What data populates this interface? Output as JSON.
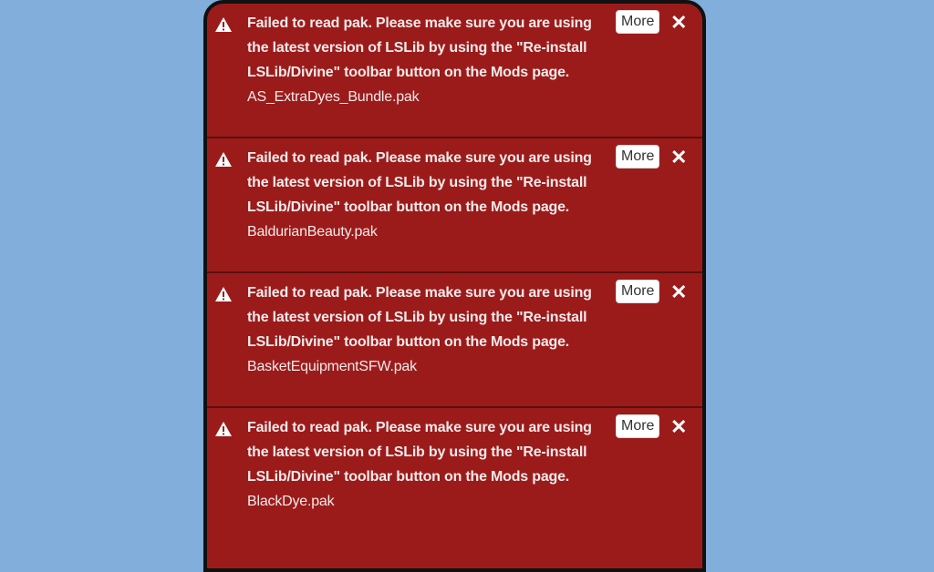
{
  "notifications": [
    {
      "message": "Failed to read pak. Please make sure you are using the latest version of LSLib by using the \"Re-install LSLib/Divine\" toolbar button on the Mods page.",
      "file": "AS_ExtraDyes_Bundle.pak",
      "more_label": "More",
      "icon": "warning-icon"
    },
    {
      "message": "Failed to read pak. Please make sure you are using the latest version of LSLib by using the \"Re-install LSLib/Divine\" toolbar button on the Mods page.",
      "file": "BaldurianBeauty.pak",
      "more_label": "More",
      "icon": "warning-icon"
    },
    {
      "message": "Failed to read pak. Please make sure you are using the latest version of LSLib by using the \"Re-install LSLib/Divine\" toolbar button on the Mods page.",
      "file": "BasketEquipmentSFW.pak",
      "more_label": "More",
      "icon": "warning-icon"
    },
    {
      "message": "Failed to read pak. Please make sure you are using the latest version of LSLib by using the \"Re-install LSLib/Divine\" toolbar button on the Mods page.",
      "file": "BlackDye.pak",
      "more_label": "More",
      "icon": "warning-icon"
    }
  ],
  "close_glyph": "✕",
  "colors": {
    "toast_bg": "#9b1b1b",
    "page_bg": "#82aedb"
  }
}
